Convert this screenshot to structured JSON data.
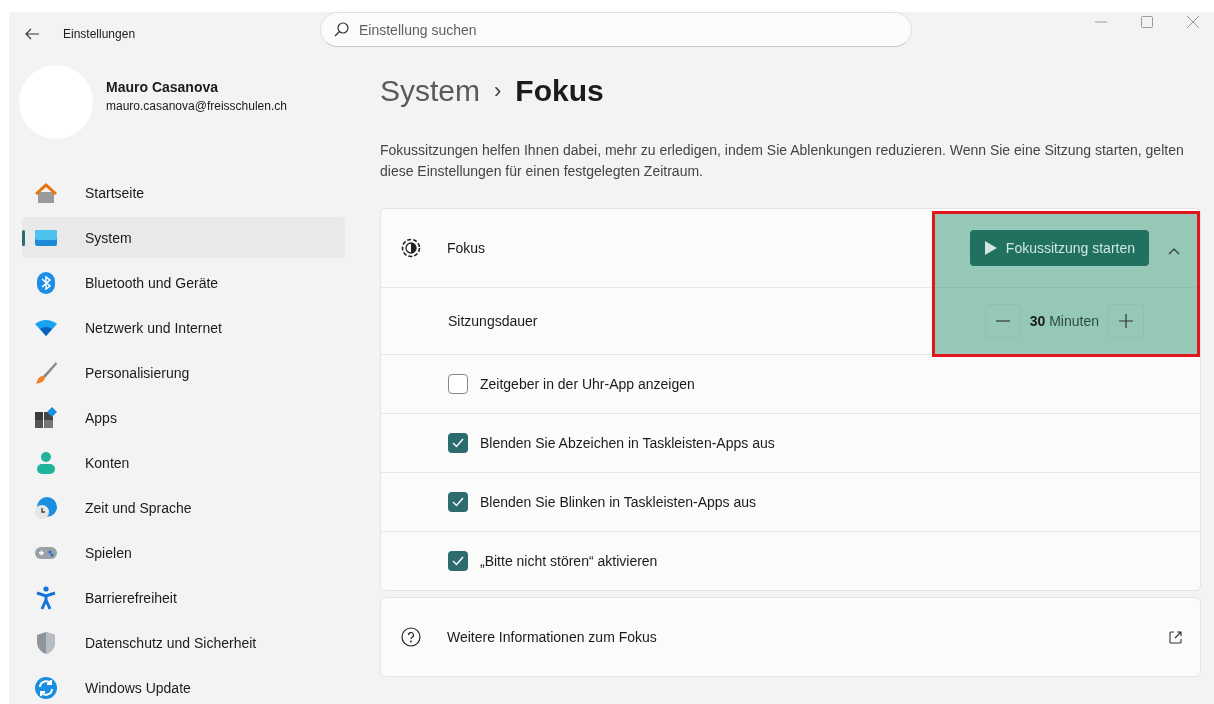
{
  "window": {
    "title": "Einstellungen",
    "search": {
      "placeholder": "Einstellung suchen"
    }
  },
  "profile": {
    "name": "Mauro Casanova",
    "email": "mauro.casanova@freisschulen.ch"
  },
  "sidebar": {
    "items": [
      {
        "label": "Startseite",
        "selected": false
      },
      {
        "label": "System",
        "selected": true
      },
      {
        "label": "Bluetooth und Geräte",
        "selected": false
      },
      {
        "label": "Netzwerk und Internet",
        "selected": false
      },
      {
        "label": "Personalisierung",
        "selected": false
      },
      {
        "label": "Apps",
        "selected": false
      },
      {
        "label": "Konten",
        "selected": false
      },
      {
        "label": "Zeit und Sprache",
        "selected": false
      },
      {
        "label": "Spielen",
        "selected": false
      },
      {
        "label": "Barrierefreiheit",
        "selected": false
      },
      {
        "label": "Datenschutz und Sicherheit",
        "selected": false
      },
      {
        "label": "Windows Update",
        "selected": false
      }
    ]
  },
  "breadcrumb": {
    "parent": "System",
    "separator": "›",
    "current": "Fokus"
  },
  "description": "Fokussitzungen helfen Ihnen dabei, mehr zu erledigen, indem Sie Ablenkungen reduzieren. Wenn Sie eine Sitzung starten, gelten diese Einstellungen für einen festgelegten Zeitraum.",
  "focus_card": {
    "title": "Fokus",
    "expanded": true,
    "start_button": "Fokussitzung starten",
    "duration": {
      "label": "Sitzungsdauer",
      "value": "30",
      "unit": "Minuten"
    },
    "options": [
      {
        "label": "Zeitgeber in der Uhr-App anzeigen",
        "checked": false
      },
      {
        "label": "Blenden Sie Abzeichen in Taskleisten-Apps aus",
        "checked": true
      },
      {
        "label": "Blenden Sie Blinken in Taskleisten-Apps aus",
        "checked": true
      },
      {
        "label": "„Bitte nicht stören“ aktivieren",
        "checked": true
      }
    ]
  },
  "info_link": {
    "label": "Weitere Informationen zum Fokus"
  },
  "annotation": {
    "kind": "highlight-box"
  }
}
